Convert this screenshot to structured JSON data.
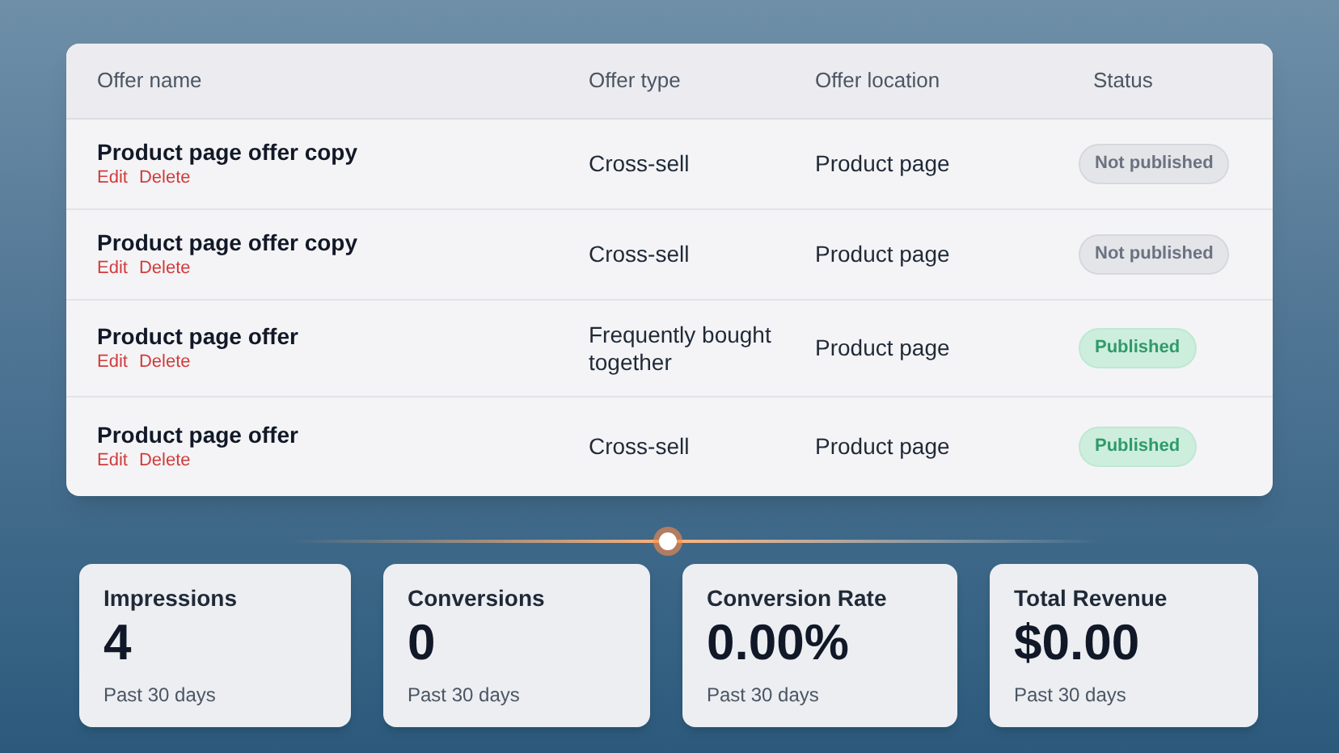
{
  "table": {
    "columns": [
      "Offer name",
      "Offer type",
      "Offer location",
      "Status"
    ],
    "rows": [
      {
        "name": "Product page offer copy",
        "actions": [
          "Edit",
          "Delete"
        ],
        "type": "Cross-sell",
        "location": "Product page",
        "status": {
          "label": "Not published",
          "kind": "draft"
        }
      },
      {
        "name": "Product page offer copy",
        "actions": [
          "Edit",
          "Delete"
        ],
        "type": "Cross-sell",
        "location": "Product page",
        "status": {
          "label": "Not published",
          "kind": "draft"
        }
      },
      {
        "name": "Product page offer",
        "actions": [
          "Edit",
          "Delete"
        ],
        "type": "Frequently bought together",
        "location": "Product page",
        "status": {
          "label": "Published",
          "kind": "published"
        }
      },
      {
        "name": "Product page offer",
        "actions": [
          "Edit",
          "Delete"
        ],
        "type": "Cross-sell",
        "location": "Product page",
        "status": {
          "label": "Published",
          "kind": "published"
        }
      }
    ]
  },
  "stats": [
    {
      "title": "Impressions",
      "value": "4",
      "caption": "Past 30 days"
    },
    {
      "title": "Conversions",
      "value": "0",
      "caption": "Past 30 days"
    },
    {
      "title": "Conversion Rate",
      "value": "0.00%",
      "caption": "Past 30 days"
    },
    {
      "title": "Total Revenue",
      "value": "$0.00",
      "caption": "Past 30 days"
    }
  ]
}
